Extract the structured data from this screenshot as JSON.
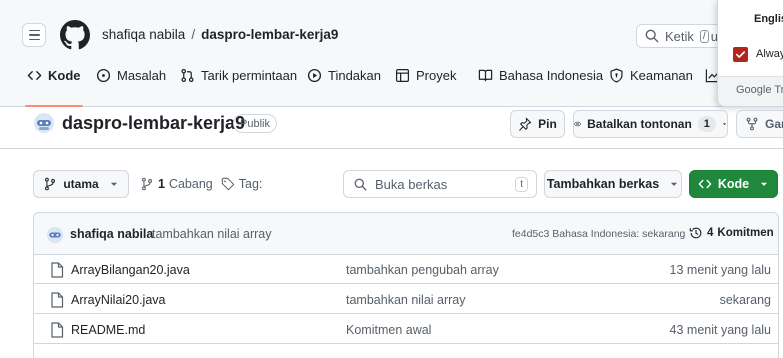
{
  "header": {
    "owner": "shafiqa nabila",
    "separator": "/",
    "repo": "daspro-lembar-kerja9",
    "search_prefix": "Ketik",
    "search_key": "/",
    "search_suffix": "un"
  },
  "tabs": [
    {
      "label": "Kode",
      "icon": "code-icon",
      "active": true
    },
    {
      "label": "Masalah",
      "icon": "issue-icon"
    },
    {
      "label": "Tarik permintaan",
      "icon": "pull-request-icon"
    },
    {
      "label": "Tindakan",
      "icon": "play-icon"
    },
    {
      "label": "Proyek",
      "icon": "table-icon"
    },
    {
      "label": "Bahasa Indonesia",
      "icon": "book-icon"
    },
    {
      "label": "Keamanan",
      "icon": "shield-icon"
    }
  ],
  "translate_popup": {
    "language": "English",
    "always_label": "Always",
    "google_label": "Google Tra"
  },
  "repo_header": {
    "title": "daspro-lembar-kerja9",
    "visibility": "Publik",
    "pin_label": "Pin",
    "watch_label": "Batalkan tontonan",
    "watch_count": "1",
    "fork_label": "Garp"
  },
  "branch_bar": {
    "branch": "utama",
    "branch_count": "1",
    "branch_word": "Cabang",
    "tags_label": "Tag:",
    "file_search_placeholder": "Buka berkas",
    "file_search_key": "t",
    "add_file_label": "Tambahkan berkas",
    "code_label": "Kode"
  },
  "latest_commit": {
    "author": "shafiqa nabila",
    "message": "tambahkan nilai array",
    "meta": "fe4d5c3 Bahasa Indonesia: sekarang",
    "commits_count": "4",
    "commits_word": "Komitmen"
  },
  "files": [
    {
      "name": "ArrayBilangan20.java",
      "commit": "tambahkan pengubah array",
      "time": "13 menit yang lalu"
    },
    {
      "name": "ArrayNilai20.java",
      "commit": "tambahkan nilai array",
      "time": "sekarang"
    },
    {
      "name": "README.md",
      "commit": "Komitmen awal",
      "time": "43 menit yang lalu"
    }
  ],
  "colors": {
    "accent_tab": "#fd8c73",
    "code_button": "#1f883d",
    "checkbox": "#b3261e"
  }
}
